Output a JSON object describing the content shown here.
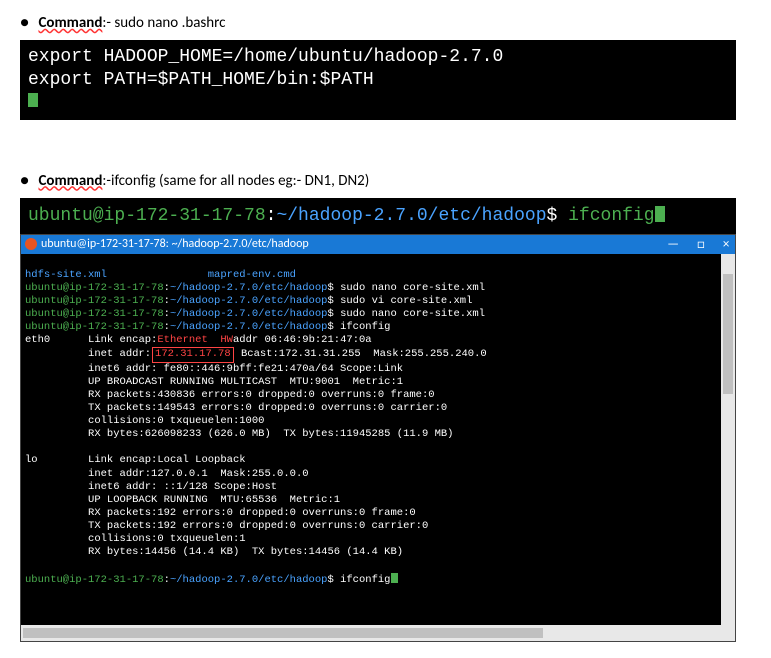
{
  "section1": {
    "bullet": "●",
    "label": "Command",
    "rest": ":- sudo nano .bashrc"
  },
  "term1": {
    "line1": "export HADOOP_HOME=/home/ubuntu/hadoop-2.7.0",
    "line2": "export PATH=$PATH_HOME/bin:$PATH"
  },
  "section2": {
    "bullet": "●",
    "label": "Command",
    "rest": ":-ifconfig (same for all nodes eg:- DN1, DN2)"
  },
  "prompt2": {
    "userhost": "ubuntu@ip-172-31-17-78",
    "colon": ":",
    "path": "~/hadoop-2.7.0/etc/hadoop",
    "dollar": "$ ",
    "cmd": "ifconfig"
  },
  "win": {
    "title": "ubuntu@ip-172-31-17-78: ~/hadoop-2.7.0/etc/hadoop",
    "btn_min": "—",
    "btn_max": "□",
    "btn_close": "×"
  },
  "body": {
    "l1a": "hdfs-site.xml",
    "l1b": "mapred-env.cmd",
    "p1_user": "ubuntu@ip-172-31-17-78",
    "p1_path": "~/hadoop-2.7.0/etc/hadoop",
    "p1_cmd1": "sudo nano core-site.xml",
    "p1_cmd2": "sudo vi core-site.xml",
    "p1_cmd3": "sudo nano core-site.xml",
    "p1_cmd4": "ifconfig",
    "eth0": "eth0",
    "eth0_l1a": "Link encap:",
    "eth0_l1b": "Ethernet  HW",
    "eth0_l1c": "addr 06:46:9b:21:47:0a",
    "eth0_l2a": "inet addr:",
    "eth0_l2b_box": "172.31.17.78",
    "eth0_l2c": "Bcast:172.31.31.255  Mask:255.255.240.0",
    "eth0_l3": "inet6 addr: fe80::446:9bff:fe21:470a/64 Scope:Link",
    "eth0_l4": "UP BROADCAST RUNNING MULTICAST  MTU:9001  Metric:1",
    "eth0_l5": "RX packets:430836 errors:0 dropped:0 overruns:0 frame:0",
    "eth0_l6": "TX packets:149543 errors:0 dropped:0 overruns:0 carrier:0",
    "eth0_l7": "collisions:0 txqueuelen:1000",
    "eth0_l8": "RX bytes:626098233 (626.0 MB)  TX bytes:11945285 (11.9 MB)",
    "lo": "lo",
    "lo_l1": "Link encap:Local Loopback",
    "lo_l2": "inet addr:127.0.0.1  Mask:255.0.0.0",
    "lo_l3": "inet6 addr: ::1/128 Scope:Host",
    "lo_l4": "UP LOOPBACK RUNNING  MTU:65536  Metric:1",
    "lo_l5": "RX packets:192 errors:0 dropped:0 overruns:0 frame:0",
    "lo_l6": "TX packets:192 errors:0 dropped:0 overruns:0 carrier:0",
    "lo_l7": "collisions:0 txqueuelen:1",
    "lo_l8": "RX bytes:14456 (14.4 KB)  TX bytes:14456 (14.4 KB)",
    "last_user": "ubuntu@ip-172-31-17-78",
    "last_path": "~/hadoop-2.7.0/etc/hadoop",
    "last_cmd": "ifconfig"
  }
}
